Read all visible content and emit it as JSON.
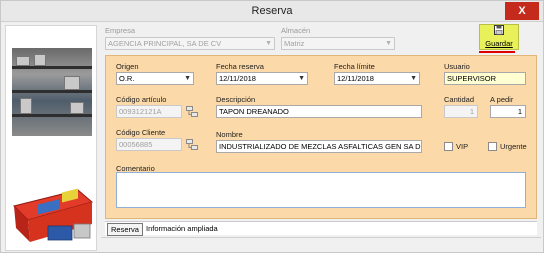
{
  "window": {
    "title": "Reserva",
    "close_glyph": "X"
  },
  "top": {
    "empresa_label": "Empresa",
    "empresa_value": "AGENCIA PRINCIPAL, SA DE CV",
    "almacen_label": "Almacén",
    "almacen_value": "Matriz",
    "guardar_label": "Guardar"
  },
  "form": {
    "origen_label": "Origen",
    "origen_value": "O.R.",
    "fecha_reserva_label": "Fecha reserva",
    "fecha_reserva_value": "12/11/2018",
    "fecha_limite_label": "Fecha límite",
    "fecha_limite_value": "12/11/2018",
    "usuario_label": "Usuario",
    "usuario_value": "SUPERVISOR",
    "codigo_articulo_label": "Código artículo",
    "codigo_articulo_value": "009312121A",
    "descripcion_label": "Descripción",
    "descripcion_value": "TAPON DREANADO",
    "cantidad_label": "Cantidad",
    "cantidad_value": "1",
    "a_pedir_label": "A pedir",
    "a_pedir_value": "1",
    "codigo_cliente_label": "Código Cliente",
    "codigo_cliente_value": "00056885",
    "nombre_label": "Nombre",
    "nombre_value": "INDUSTRIALIZADO DE MEZCLAS ASFALTICAS GEN SA DE C",
    "vip_label": "VIP",
    "urgente_label": "Urgente",
    "comentario_label": "Comentario",
    "comentario_value": ""
  },
  "tabs": [
    {
      "label": "Reserva",
      "active": true
    },
    {
      "label": "Información ampliada",
      "active": false
    }
  ],
  "icons": {
    "dropdown": "chevron-down-icon",
    "lookup": "lookup-icon",
    "save": "floppy-disk-icon",
    "close": "close-icon"
  },
  "colors": {
    "panel_bg": "#fcd9a8",
    "guardar_bg": "#e8f05a",
    "close_bg": "#c42b1c",
    "usuario_bg": "#ffffd2",
    "annotation": "#e00000"
  }
}
